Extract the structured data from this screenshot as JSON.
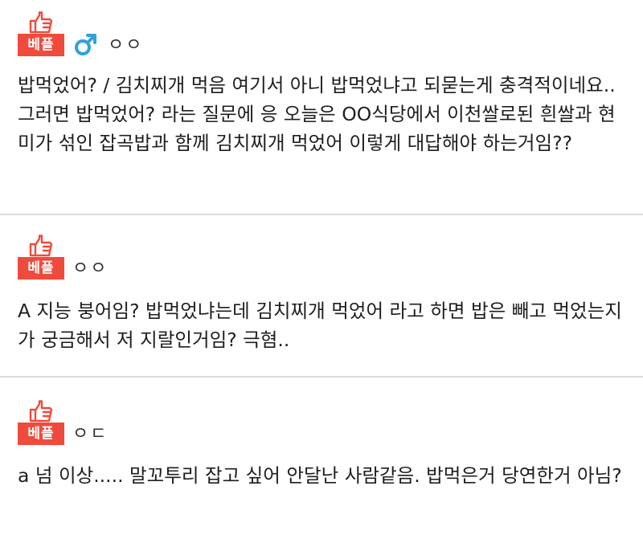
{
  "comments": [
    {
      "badge": "베플",
      "gender_icon": "male-icon",
      "nickname": "ㅇㅇ",
      "text": "밥먹었어? / 김치찌개 먹음 여기서 아니 밥먹었냐고 되묻는게 충격적이네요.. 그러면 밥먹었어? 라는 질문에 응 오늘은 OO식당에서 이천쌀로된 흰쌀과 현미가 섞인 잡곡밥과 함께 김치찌개 먹었어 이렇게 대답해야 하는거임??"
    },
    {
      "badge": "베플",
      "nickname": "ㅇㅇ",
      "text": "A 지능 붕어임? 밥먹었냐는데 김치찌개 먹었어 라고 하면 밥은 빼고 먹었는지가 궁금해서 저 지랄인거임? 극혐.."
    },
    {
      "badge": "베플",
      "nickname": "ㅇㄷ",
      "text": "a 넘 이상..... 말꼬투리 잡고 싶어 안달난 사람같음. 밥먹은거 당연한거 아님?"
    }
  ],
  "colors": {
    "badge_red": "#ef4a3c",
    "male_blue": "#2ea3dc",
    "divider": "#dcdcdc"
  }
}
